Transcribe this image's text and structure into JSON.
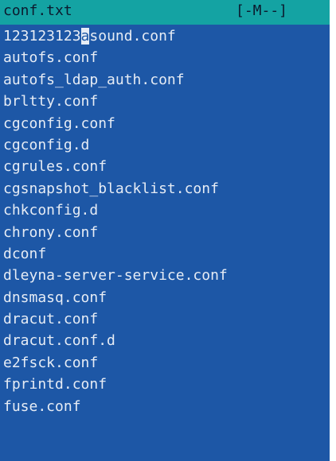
{
  "status_bar": {
    "filename": "conf.txt",
    "flags": "[-M--]"
  },
  "editor": {
    "first_line": {
      "before_cursor": "123123123",
      "cursor_char": "a",
      "after_cursor": "sound.conf"
    },
    "lines": [
      "autofs.conf",
      "autofs_ldap_auth.conf",
      "brltty.conf",
      "cgconfig.conf",
      "cgconfig.d",
      "cgrules.conf",
      "cgsnapshot_blacklist.conf",
      "chkconfig.d",
      "chrony.conf",
      "dconf",
      "dleyna-server-service.conf",
      "dnsmasq.conf",
      "dracut.conf",
      "dracut.conf.d",
      "e2fsck.conf",
      "fprintd.conf",
      "fuse.conf"
    ]
  },
  "colors": {
    "editor_bg": "#1d57a6",
    "status_bg": "#14a3a3",
    "text": "#e6ecf5"
  }
}
